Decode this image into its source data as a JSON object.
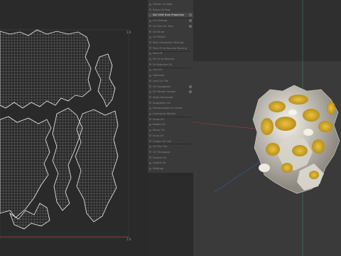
{
  "uv_editor": {
    "corner_labels": {
      "top_right": "1.0",
      "bottom_right": "1.0"
    }
  },
  "menu": {
    "items": [
      {
        "label": "Flatten UV Map",
        "active": false,
        "has_shortcut": false
      },
      {
        "label": "Relax UV Map",
        "active": false,
        "has_shortcut": false
      },
      {
        "label": "Set UVW from Projection",
        "active": true,
        "has_shortcut": true
      },
      {
        "label": "UV Unwrap",
        "active": false,
        "has_shortcut": true
      },
      {
        "label": "UV Peel UV Tree",
        "active": false,
        "has_shortcut": true
      },
      {
        "label": "UV Mirror",
        "active": false,
        "has_shortcut": false
      },
      {
        "label": "UV Packer",
        "active": false,
        "has_shortcut": false
      },
      {
        "label": "Pack Geometric Packing",
        "active": false,
        "has_shortcut": false
      },
      {
        "label": "Pack Fit to Bounds Packing",
        "active": false,
        "has_shortcut": false
      },
      {
        "label": "Pack Fit",
        "active": false,
        "has_shortcut": false
      },
      {
        "label": "Fit UV to Bounds",
        "active": false,
        "has_shortcut": false
      },
      {
        "label": "Fit Selected UV",
        "active": false,
        "has_shortcut": false
      },
      {
        "label": "Grid UV",
        "active": false,
        "has_shortcut": false
      },
      {
        "label": "Optimize",
        "active": false,
        "has_shortcut": false
      },
      {
        "label": "Lock UV Tile",
        "active": false,
        "has_shortcut": false
      },
      {
        "label": "UV Straighten",
        "active": false,
        "has_shortcut": true
      },
      {
        "label": "UV Terrain Islands",
        "active": false,
        "has_shortcut": true
      },
      {
        "label": "Align Horizontal",
        "active": false,
        "has_shortcut": false
      },
      {
        "label": "Straighten UV",
        "active": false,
        "has_shortcut": false
      },
      {
        "label": "Rectangulate to Corner",
        "active": false,
        "has_shortcut": false
      },
      {
        "label": "Unwrap to Stretch",
        "active": false,
        "has_shortcut": false
      },
      {
        "label": "Scale UV",
        "active": false,
        "has_shortcut": false
      },
      {
        "label": "Rotate UV",
        "active": false,
        "has_shortcut": false
      },
      {
        "label": "Mirror UV",
        "active": false,
        "has_shortcut": false
      },
      {
        "label": "Snap UV",
        "active": false,
        "has_shortcut": false
      },
      {
        "label": "Center UV Cell",
        "active": false,
        "has_shortcut": false
      },
      {
        "label": "UV Flip Tile",
        "active": false,
        "has_shortcut": false
      },
      {
        "label": "UV Transpose",
        "active": false,
        "has_shortcut": false
      },
      {
        "label": "Stretch UV",
        "active": false,
        "has_shortcut": false
      },
      {
        "label": "Isolate UV",
        "active": false,
        "has_shortcut": false
      },
      {
        "label": "Settings",
        "active": false,
        "has_shortcut": false
      }
    ]
  },
  "colors": {
    "accent_yellow": "#e1b427",
    "mesh_white": "#e6e1d6",
    "axis_x": "#c04040",
    "axis_y": "#40a080",
    "axis_z": "#4060c0"
  }
}
